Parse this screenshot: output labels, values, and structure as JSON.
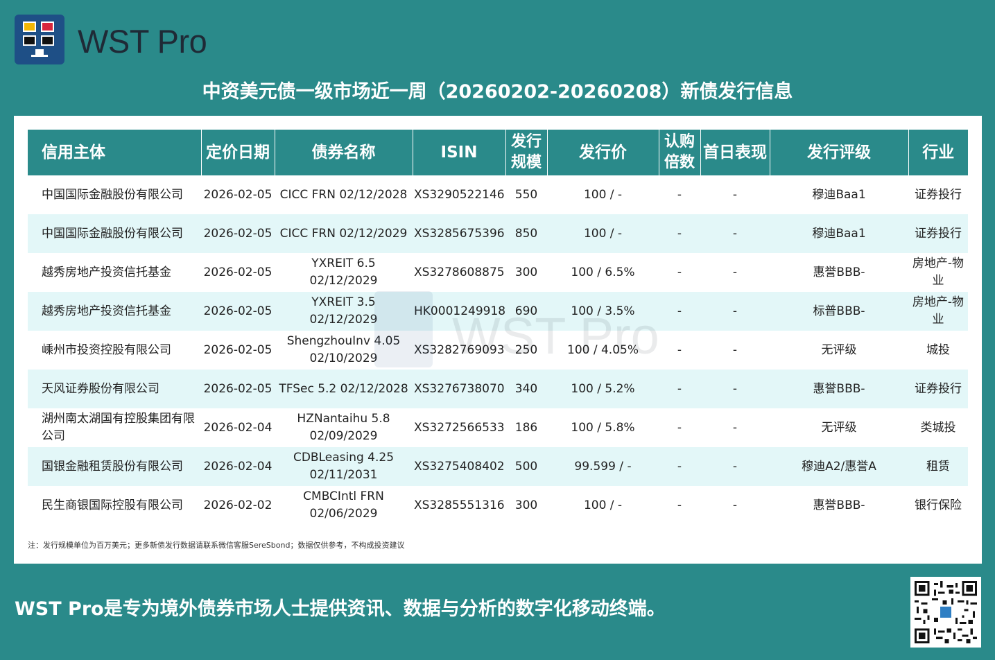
{
  "header": {
    "brand": "WST Pro",
    "title": "中资美元债一级市场近一周（20260202-20260208）新债发行信息"
  },
  "table": {
    "columns": [
      "信用主体",
      "定价日期",
      "债券名称",
      "ISIN",
      "发行规模",
      "发行价",
      "认购倍数",
      "首日表现",
      "发行评级",
      "行业"
    ],
    "rows": [
      {
        "issuer": "中国国际金融股份有限公司",
        "date": "2026-02-05",
        "bond": "CICC FRN 02/12/2028",
        "isin": "XS3290522146",
        "size": "550",
        "price": "100 / -",
        "sub": "-",
        "firstday": "-",
        "rating": "穆迪Baa1",
        "industry": "证券投行"
      },
      {
        "issuer": "中国国际金融股份有限公司",
        "date": "2026-02-05",
        "bond": "CICC FRN 02/12/2029",
        "isin": "XS3285675396",
        "size": "850",
        "price": "100 / -",
        "sub": "-",
        "firstday": "-",
        "rating": "穆迪Baa1",
        "industry": "证券投行"
      },
      {
        "issuer": "越秀房地产投资信托基金",
        "date": "2026-02-05",
        "bond": "YXREIT 6.5 02/12/2029",
        "isin": "XS3278608875",
        "size": "300",
        "price": "100 / 6.5%",
        "sub": "-",
        "firstday": "-",
        "rating": "惠誉BBB-",
        "industry": "房地产-物业"
      },
      {
        "issuer": "越秀房地产投资信托基金",
        "date": "2026-02-05",
        "bond": "YXREIT 3.5 02/12/2029",
        "isin": "HK0001249918",
        "size": "690",
        "price": "100 / 3.5%",
        "sub": "-",
        "firstday": "-",
        "rating": "标普BBB-",
        "industry": "房地产-物业"
      },
      {
        "issuer": "嵊州市投资控股有限公司",
        "date": "2026-02-05",
        "bond": "ShengzhouInv 4.05 02/10/2029",
        "isin": "XS3282769093",
        "size": "250",
        "price": "100 / 4.05%",
        "sub": "-",
        "firstday": "-",
        "rating": "无评级",
        "industry": "城投"
      },
      {
        "issuer": "天风证券股份有限公司",
        "date": "2026-02-05",
        "bond": "TFSec 5.2 02/12/2028",
        "isin": "XS3276738070",
        "size": "340",
        "price": "100 / 5.2%",
        "sub": "-",
        "firstday": "-",
        "rating": "惠誉BBB-",
        "industry": "证券投行"
      },
      {
        "issuer": "湖州南太湖国有控股集团有限公司",
        "date": "2026-02-04",
        "bond": "HZNantaihu 5.8 02/09/2029",
        "isin": "XS3272566533",
        "size": "186",
        "price": "100 / 5.8%",
        "sub": "-",
        "firstday": "-",
        "rating": "无评级",
        "industry": "类城投"
      },
      {
        "issuer": "国银金融租赁股份有限公司",
        "date": "2026-02-04",
        "bond": "CDBLeasing 4.25 02/11/2031",
        "isin": "XS3275408402",
        "size": "500",
        "price": "99.599 / -",
        "sub": "-",
        "firstday": "-",
        "rating": "穆迪A2/惠誉A",
        "industry": "租赁"
      },
      {
        "issuer": "民生商银国际控股有限公司",
        "date": "2026-02-02",
        "bond": "CMBCIntl FRN 02/06/2029",
        "isin": "XS3285551316",
        "size": "300",
        "price": "100 / -",
        "sub": "-",
        "firstday": "-",
        "rating": "惠誉BBB-",
        "industry": "银行保险"
      }
    ]
  },
  "note": "注：发行规模单位为百万美元；更多新债发行数据请联系微信客服SereSbond；数据仅供参考，不构成投资建议",
  "footer": {
    "tagline": "WST Pro是专为境外债券市场人士提供资讯、数据与分析的数字化移动终端。"
  },
  "colors": {
    "background": "#2a8a8a",
    "header_row": "#2a8a8a",
    "alt_row": "#e3f7f8",
    "logo": "#1e4f86"
  }
}
